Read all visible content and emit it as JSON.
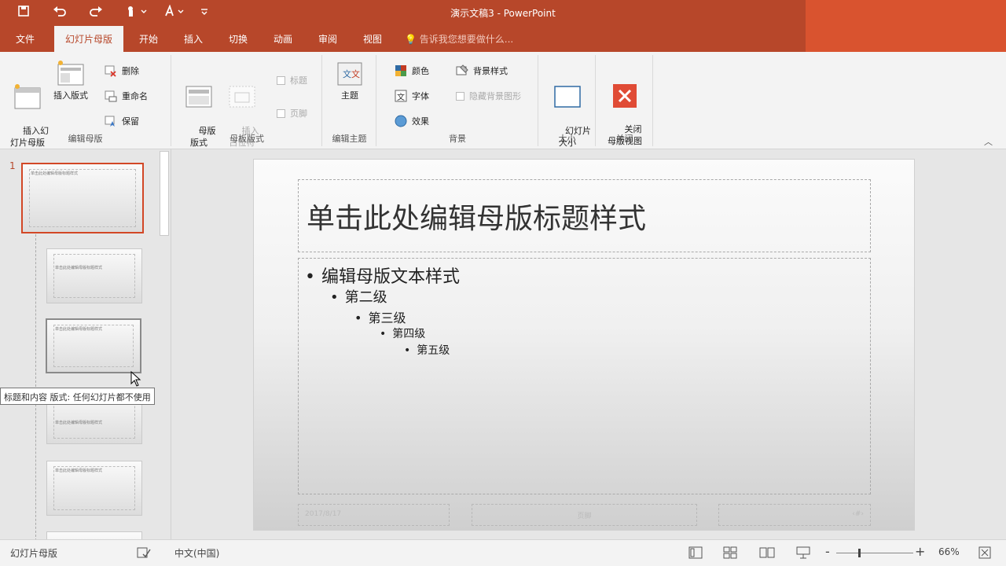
{
  "quick_access": {
    "save_icon": "save-icon",
    "undo_icon": "undo-icon",
    "redo_icon": "redo-icon",
    "touch_icon": "touch-mode-icon",
    "font_icon": "font-color-icon",
    "customize_icon": "customize-icon"
  },
  "window": {
    "title": "演示文稿3 - PowerPoint"
  },
  "tabs": [
    {
      "label": "文件"
    },
    {
      "label": "幻灯片母版",
      "active": true
    },
    {
      "label": "开始"
    },
    {
      "label": "插入"
    },
    {
      "label": "切换"
    },
    {
      "label": "动画"
    },
    {
      "label": "审阅"
    },
    {
      "label": "视图"
    }
  ],
  "tell_me": "告诉我您想要做什么...",
  "ribbon": {
    "edit_master": {
      "label": "编辑母版",
      "insert_master": "插入幻\n灯片母版",
      "insert_layout": "插入版式",
      "delete": "删除",
      "rename": "重命名",
      "preserve": "保留"
    },
    "master_layout": {
      "label": "母板版式",
      "master_layout_btn": "母版\n版式",
      "insert_placeholder": "插入\n占位符",
      "title_check": "标题",
      "footer_check": "页脚"
    },
    "edit_theme": {
      "label": "编辑主题",
      "themes": "主题"
    },
    "background": {
      "label": "背景",
      "colors": "颜色",
      "fonts": "字体",
      "effects": "效果",
      "bg_styles": "背景样式",
      "hide_bg": "隐藏背景图形"
    },
    "size": {
      "label": "大小",
      "slide_size": "幻灯片\n大小"
    },
    "close": {
      "label": "关闭",
      "close_master": "关闭\n母版视图"
    }
  },
  "thumbnails": {
    "slide_number": "1",
    "title_text": "单击此处编辑母版标题样式",
    "tooltip": "标题和内容 版式: 任何幻灯片都不使用"
  },
  "slide": {
    "title": "单击此处编辑母版标题样式",
    "levels": [
      "编辑母版文本样式",
      "第二级",
      "第三级",
      "第四级",
      "第五级"
    ],
    "footer_date": "2017/8/17",
    "footer_text": "页脚",
    "footer_num": "‹#›"
  },
  "status": {
    "view_name": "幻灯片母版",
    "language": "中文(中国)",
    "zoom": "66%"
  },
  "colors": {
    "accent": "#b7472a",
    "close_red": "#e04b35"
  }
}
